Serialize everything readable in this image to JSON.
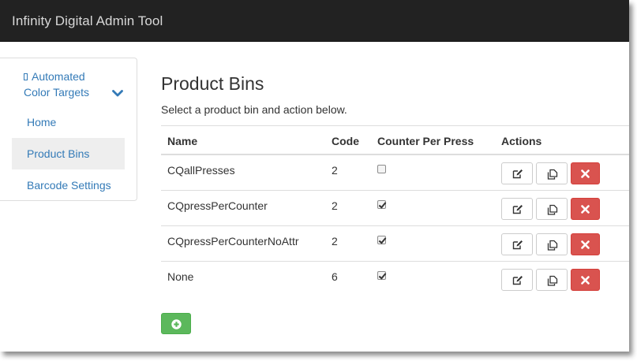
{
  "app": {
    "title": "Infinity Digital Admin Tool"
  },
  "sidebar": {
    "items": [
      {
        "label_line1": "Automated",
        "label_line2": "Color Targets",
        "expanded": true,
        "icon": "chevron-down-icon"
      },
      {
        "label": "Home",
        "active": false
      },
      {
        "label": "Product Bins",
        "active": true
      },
      {
        "label": "Barcode Settings",
        "active": false
      }
    ]
  },
  "main": {
    "title": "Product Bins",
    "subtitle": "Select a product bin and action below.",
    "table": {
      "headers": {
        "name": "Name",
        "code": "Code",
        "counter": "Counter Per Press",
        "actions": "Actions"
      },
      "rows": [
        {
          "name": "CQallPresses",
          "code": "2",
          "counter_per_press": false
        },
        {
          "name": "CQpressPerCounter",
          "code": "2",
          "counter_per_press": true
        },
        {
          "name": "CQpressPerCounterNoAttr",
          "code": "2",
          "counter_per_press": true
        },
        {
          "name": "None",
          "code": "6",
          "counter_per_press": true
        }
      ],
      "action_icons": [
        "edit-icon",
        "copy-icon",
        "delete-icon"
      ]
    },
    "add_button_icon": "plus-circle-icon"
  },
  "colors": {
    "navbar": "#222222",
    "link": "#337ab7",
    "danger": "#d9534f",
    "success": "#5cb85c",
    "active_bg": "#eeeeee"
  }
}
